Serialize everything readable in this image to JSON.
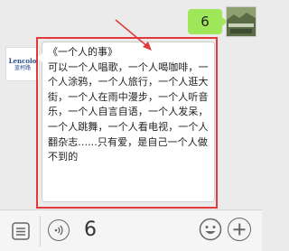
{
  "outgoing": {
    "text": "6"
  },
  "incoming": {
    "avatar": {
      "line1": "Lencolo",
      "line2": "蓝柯路"
    },
    "title": "《一个人的事》",
    "body": "可以一个人唱歌，一个人喝咖啡，一个人涂鸦，一个人旅行，一个人逛大街，一个人在雨中漫步，一个人听音乐，一个人自言自语，一个人发呆，一个人跳舞，一个人看电视，一个人翻杂志......只有爱，是自己一个人做不到的"
  },
  "annotation": {
    "color": "#e23a3a"
  },
  "input_bar": {
    "text": "6"
  },
  "icons": [
    "menu-icon",
    "voice-icon",
    "emoji-icon",
    "plus-icon"
  ]
}
